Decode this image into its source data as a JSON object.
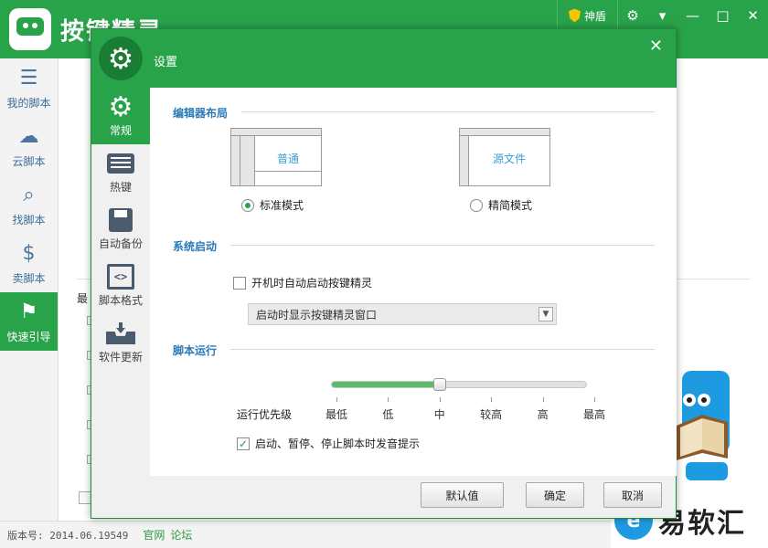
{
  "app": {
    "title": "按键精灵",
    "shendun_label": "神盾",
    "controls": {
      "settings": "⚙",
      "menu": "▾",
      "minimize": "—",
      "maximize": "□",
      "close": "✕"
    },
    "sidebar": [
      {
        "label": "我的脚本",
        "icon": "list-icon"
      },
      {
        "label": "云脚本",
        "icon": "cloud-icon"
      },
      {
        "label": "找脚本",
        "icon": "search-icon"
      },
      {
        "label": "卖脚本",
        "icon": "dollar-icon"
      },
      {
        "label": "快速引导",
        "icon": "signpost-icon",
        "active": true
      }
    ],
    "partial_text": "最",
    "status": {
      "version": "版本号: 2014.06.19549",
      "links": [
        "官网",
        "论坛"
      ]
    },
    "watermark": "易软汇",
    "accent": "#29a34a"
  },
  "dialog": {
    "title": "设置",
    "close": "✕",
    "nav": [
      {
        "label": "常规",
        "icon": "gear-icon",
        "active": true
      },
      {
        "label": "热键",
        "icon": "keyboard-icon"
      },
      {
        "label": "自动备份",
        "icon": "floppy-disk-icon"
      },
      {
        "label": "脚本格式",
        "icon": "code-icon"
      },
      {
        "label": "软件更新",
        "icon": "download-tray-icon"
      }
    ],
    "editor_layout": {
      "title": "编辑器布局",
      "options": [
        {
          "thumb_label": "普通",
          "label": "标准模式",
          "selected": true
        },
        {
          "thumb_label": "源文件",
          "label": "精简模式",
          "selected": false
        }
      ]
    },
    "startup": {
      "title": "系统启动",
      "autostart_label": "开机时自动启动按键精灵",
      "autostart_checked": false,
      "startup_select_value": "启动时显示按键精灵窗口"
    },
    "script_run": {
      "title": "脚本运行",
      "priority_label": "运行优先级",
      "priority_levels": [
        "最低",
        "低",
        "中",
        "较高",
        "高",
        "最高"
      ],
      "priority_selected_index": 2,
      "sound_label": "启动、暂停、停止脚本时发音提示",
      "sound_checked": true
    },
    "buttons": {
      "default": "默认值",
      "ok": "确定",
      "cancel": "取消"
    }
  }
}
